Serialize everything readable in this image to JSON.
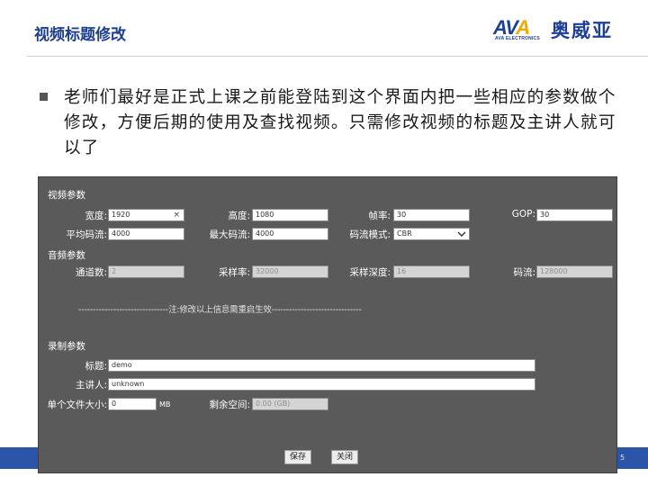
{
  "slide": {
    "title": "视频标题修改",
    "bullet_text": "老师们最好是正式上课之前能登陆到这个界面内把一些相应的参数做个修改，方便后期的使用及查找视频。只需修改视频的标题及主讲人就可以了"
  },
  "logo": {
    "mark_left": "AV",
    "mark_mid": "A",
    "sub": "AVA ELECTRONICS",
    "chinese": "奥威亚"
  },
  "panel": {
    "video_section": "视频参数",
    "audio_section": "音频参数",
    "record_section": "录制参数",
    "fields": {
      "width": {
        "label": "宽度:",
        "value": "1920"
      },
      "height": {
        "label": "高度:",
        "value": "1080"
      },
      "framerate": {
        "label": "帧率:",
        "value": "30"
      },
      "gop": {
        "label": "GOP:",
        "value": "30"
      },
      "avg_bitrate": {
        "label": "平均码流:",
        "value": "4000"
      },
      "max_bitrate": {
        "label": "最大码流:",
        "value": "4000"
      },
      "rate_mode": {
        "label": "码流模式:",
        "value": "CBR"
      },
      "channels": {
        "label": "通道数:",
        "value": "2"
      },
      "samplerate": {
        "label": "采样率:",
        "value": "32000"
      },
      "sampledepth": {
        "label": "采样深度:",
        "value": "16"
      },
      "audio_bitrate": {
        "label": "码流:",
        "value": "128000"
      },
      "title": {
        "label": "标题:",
        "value": "demo"
      },
      "speaker": {
        "label": "主讲人:",
        "value": "unknown"
      },
      "filesize": {
        "label": "单个文件大小:",
        "value": "0",
        "unit": "MB"
      },
      "freespace": {
        "label": "剩余空间:",
        "value": "0.00 (GB)"
      }
    },
    "divider_text": "-------------------------------注:修改以上信息需重启生效-------------------------------",
    "buttons": {
      "save": "保存",
      "close": "关闭"
    }
  },
  "footer": {
    "page_number": "5"
  }
}
